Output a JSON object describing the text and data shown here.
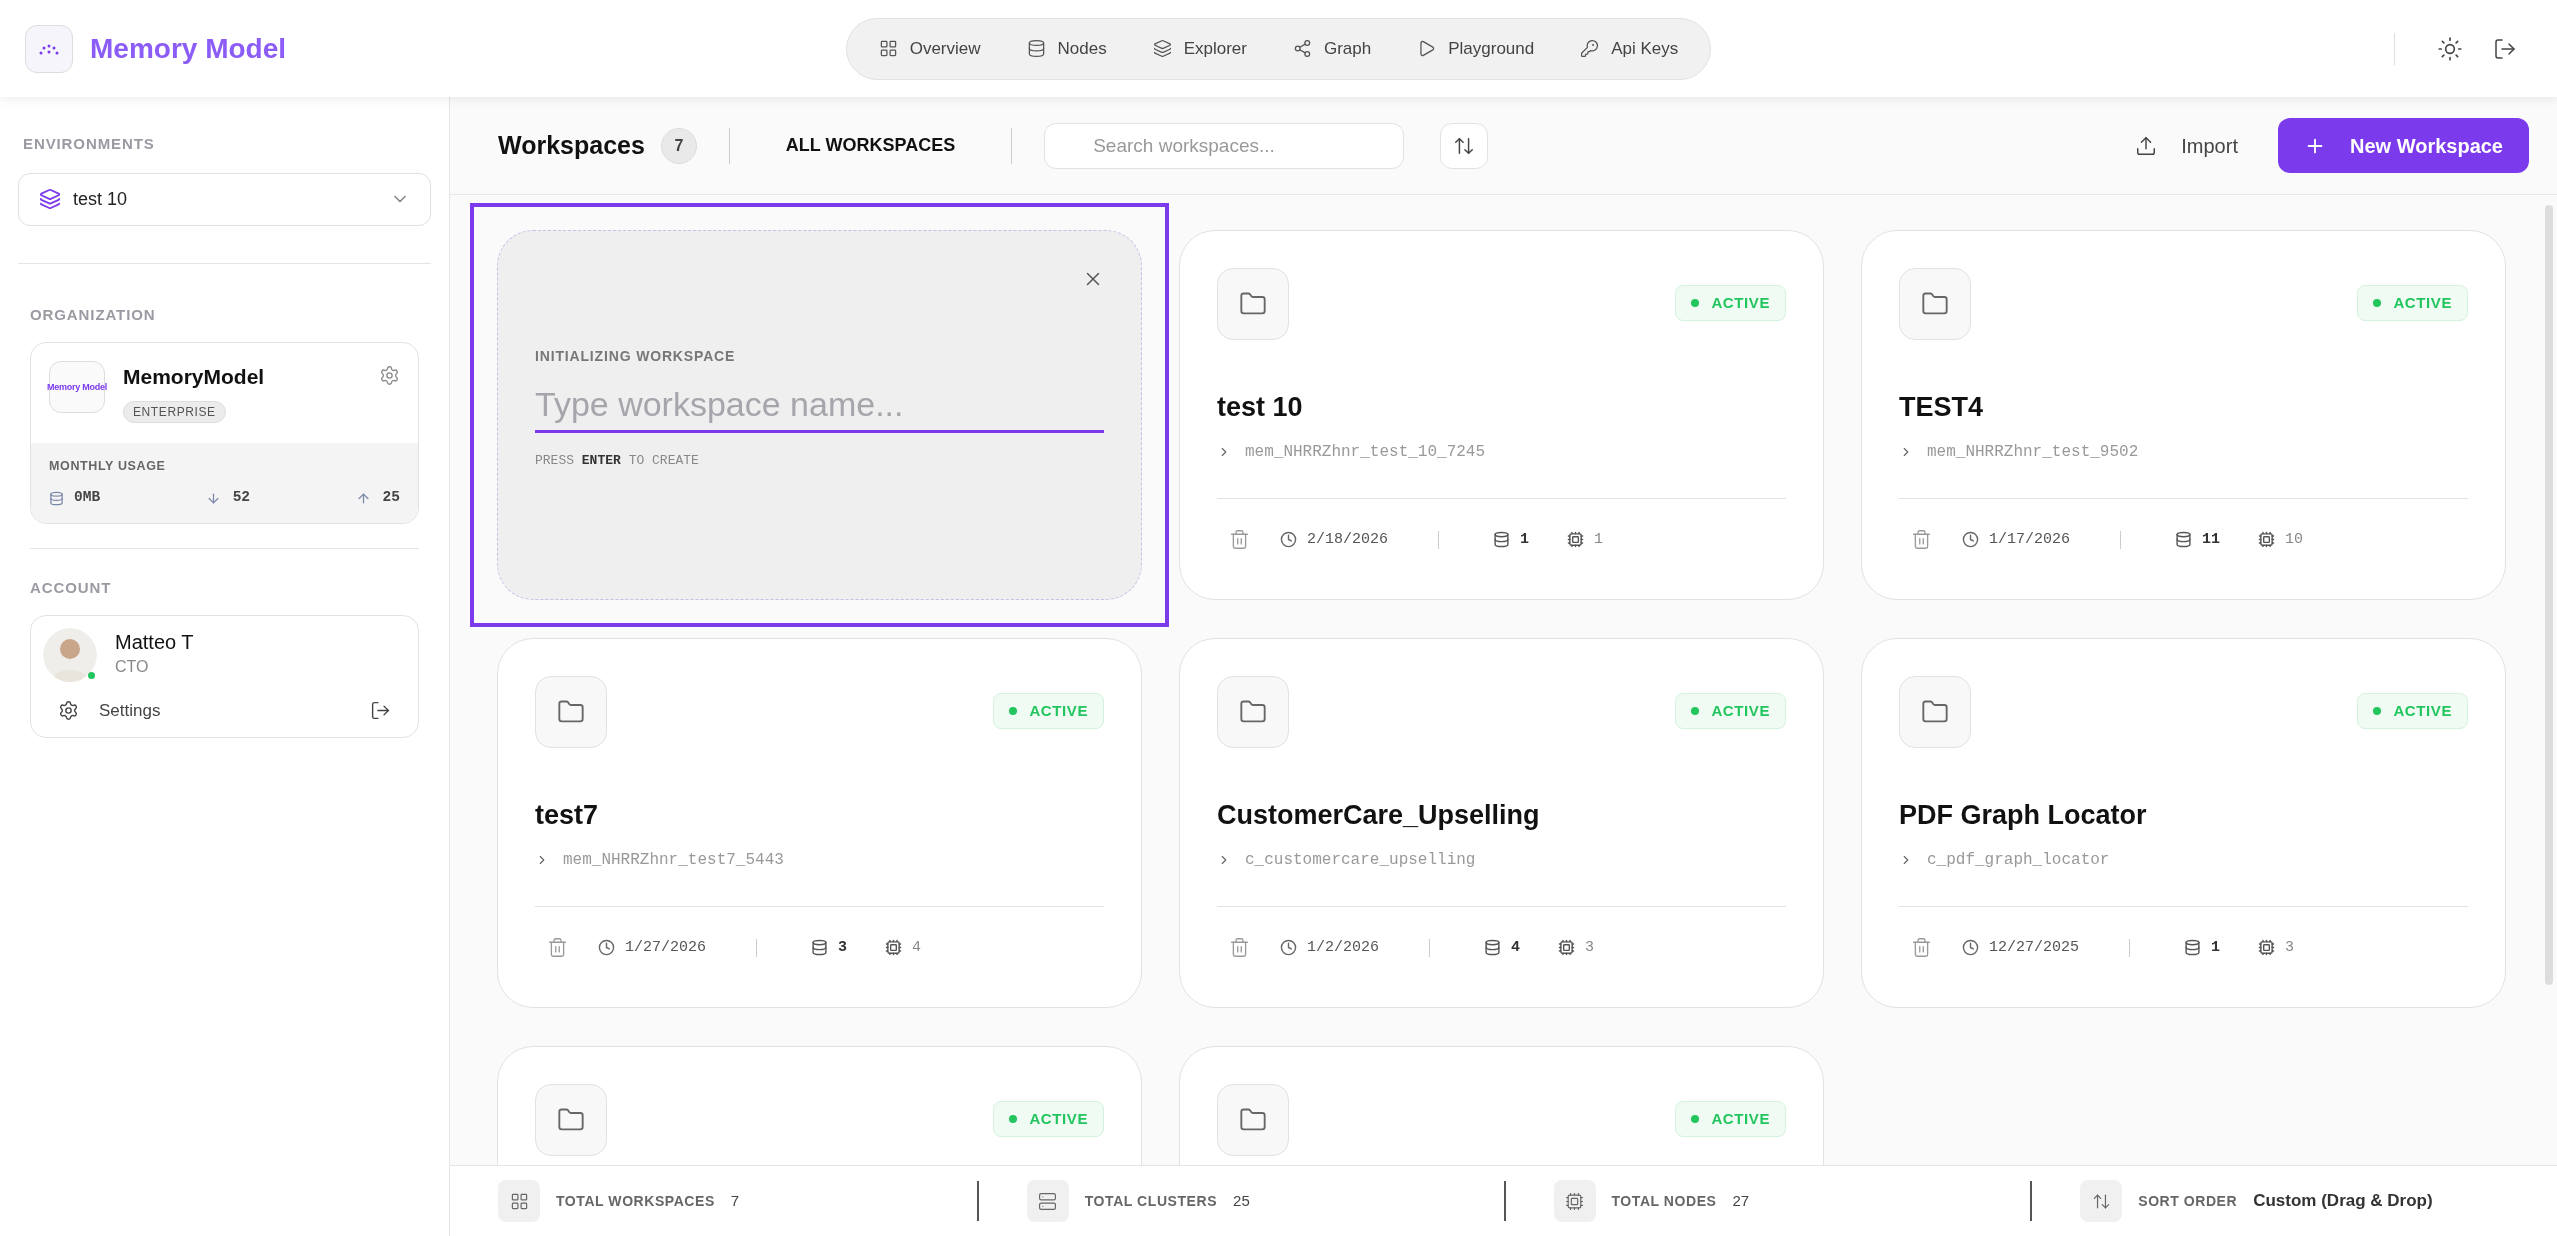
{
  "app": {
    "title": "Memory Model"
  },
  "nav": [
    {
      "label": "Overview"
    },
    {
      "label": "Nodes"
    },
    {
      "label": "Explorer"
    },
    {
      "label": "Graph"
    },
    {
      "label": "Playground"
    },
    {
      "label": "Api Keys"
    }
  ],
  "sidebar": {
    "environments": {
      "heading": "ENVIRONMENTS",
      "value": "test 10"
    },
    "organization": {
      "heading": "ORGANIZATION",
      "logo_text": "Memory Model",
      "name": "MemoryModel",
      "plan": "ENTERPRISE",
      "usage_heading": "MONTHLY USAGE",
      "storage": "0MB",
      "down": "52",
      "up": "25"
    },
    "account": {
      "heading": "ACCOUNT",
      "name": "Matteo T",
      "role": "CTO",
      "online": true,
      "settings": "Settings"
    }
  },
  "toolbar": {
    "title": "Workspaces",
    "count": "7",
    "filter": "ALL WORKSPACES",
    "search_placeholder": "Search workspaces...",
    "import": "Import",
    "new_workspace": "New Workspace"
  },
  "workspaces": [
    {
      "kind": "draft",
      "focused": true,
      "label": "INITIALIZING WORKSPACE",
      "placeholder": "Type workspace name...",
      "hint": "PRESS **ENTER** TO CREATE"
    },
    {
      "kind": "workspace",
      "status": "ACTIVE",
      "name": "test 10",
      "slug": "mem_NHRRZhnr_test_10_7245",
      "date": "2/18/2026",
      "clusters": "1",
      "nodes": "1"
    },
    {
      "kind": "workspace",
      "status": "ACTIVE",
      "name": "TEST4",
      "slug": "mem_NHRRZhnr_test_9502",
      "date": "1/17/2026",
      "clusters": "11",
      "nodes": "10"
    },
    {
      "kind": "workspace",
      "status": "ACTIVE",
      "name": "test7",
      "slug": "mem_NHRRZhnr_test7_5443",
      "date": "1/27/2026",
      "clusters": "3",
      "nodes": "4"
    },
    {
      "kind": "workspace",
      "status": "ACTIVE",
      "name": "CustomerCare_Upselling",
      "slug": "c_customercare_upselling",
      "date": "1/2/2026",
      "clusters": "4",
      "nodes": "3"
    },
    {
      "kind": "workspace",
      "status": "ACTIVE",
      "name": "PDF Graph Locator",
      "slug": "c_pdf_graph_locator",
      "date": "12/27/2025",
      "clusters": "1",
      "nodes": "3"
    },
    {
      "kind": "workspace",
      "status": "ACTIVE"
    },
    {
      "kind": "workspace",
      "status": "ACTIVE"
    }
  ],
  "footer": [
    {
      "label": "TOTAL WORKSPACES",
      "value": "7"
    },
    {
      "label": "TOTAL CLUSTERS",
      "value": "25"
    },
    {
      "label": "TOTAL NODES",
      "value": "27"
    },
    {
      "label": "SORT ORDER",
      "value": "Custom (Drag & Drop)"
    }
  ]
}
